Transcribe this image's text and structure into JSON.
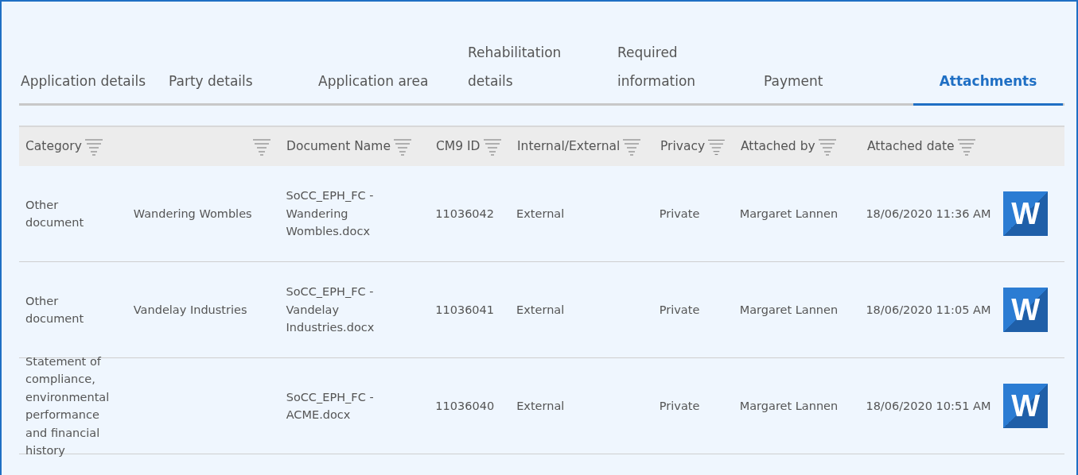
{
  "tabs": [
    {
      "label": "Application details",
      "selected": false
    },
    {
      "label": "Party details",
      "selected": false
    },
    {
      "label": "Application area",
      "selected": false
    },
    {
      "label": "Rehabilitation details",
      "selected": false
    },
    {
      "label": "Required information",
      "selected": false
    },
    {
      "label": "Payment",
      "selected": false
    },
    {
      "label": "Attachments",
      "selected": true
    }
  ],
  "table": {
    "columns": [
      {
        "label": "Category"
      },
      {},
      {
        "label": "Document Name"
      },
      {
        "label": "CM9 ID"
      },
      {
        "label": "Internal/External"
      },
      {
        "label": "Privacy"
      },
      {
        "label": "Attached by"
      },
      {
        "label": "Attached date"
      }
    ],
    "rows": [
      {
        "cells": [
          "Other document",
          "Wandering Wombles",
          "SoCC_EPH_FC - Wandering Wombles.docx",
          "11036042",
          "External",
          "Private",
          "Margaret Lannen",
          "18/06/2020 11:36 AM"
        ],
        "file_badge": "W"
      },
      {
        "cells": [
          "Other document",
          "Vandelay Industries",
          "SoCC_EPH_FC - Vandelay Industries.docx",
          "11036041",
          "External",
          "Private",
          "Margaret Lannen",
          "18/06/2020 11:05 AM"
        ],
        "file_badge": "W"
      },
      {
        "cells": [
          "Statement of compliance, environmental performance and financial history",
          "",
          "SoCC_EPH_FC - ACME.docx",
          "11036040",
          "External",
          "Private",
          "Margaret Lannen",
          "18/06/2020 10:51 AM"
        ],
        "file_badge": "W"
      }
    ]
  }
}
